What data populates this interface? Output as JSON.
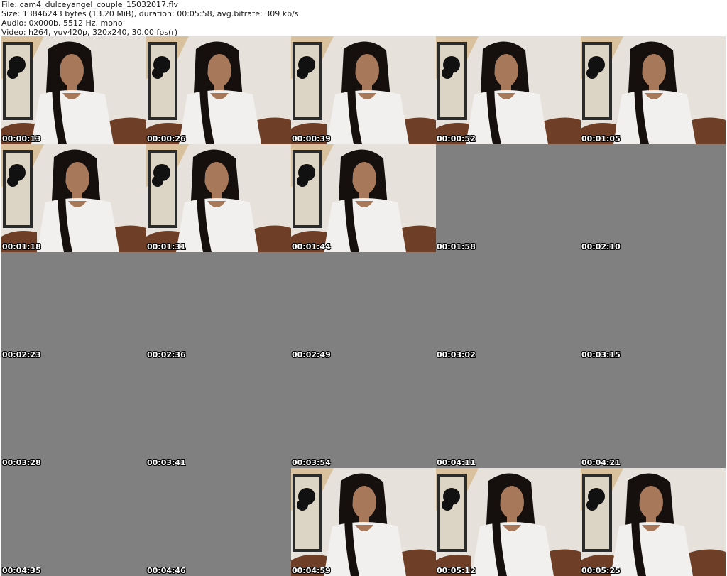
{
  "header": {
    "file": "File: cam4_dulceyangel_couple_15032017.flv",
    "size": "Size: 13846243 bytes (13.20 MiB), duration: 00:05:58, avg.bitrate: 309 kb/s",
    "audio": "Audio: 0x000b, 5512 Hz, mono",
    "video": "Video: h264, yuv420p, 320x240, 30.00 fps(r)"
  },
  "thumbnails": [
    {
      "time": "00:00:13",
      "has_frame": true
    },
    {
      "time": "00:00:26",
      "has_frame": true
    },
    {
      "time": "00:00:39",
      "has_frame": true
    },
    {
      "time": "00:00:52",
      "has_frame": true
    },
    {
      "time": "00:01:05",
      "has_frame": true
    },
    {
      "time": "00:01:18",
      "has_frame": true
    },
    {
      "time": "00:01:31",
      "has_frame": true
    },
    {
      "time": "00:01:44",
      "has_frame": true
    },
    {
      "time": "00:01:58",
      "has_frame": false
    },
    {
      "time": "00:02:10",
      "has_frame": false
    },
    {
      "time": "00:02:23",
      "has_frame": false
    },
    {
      "time": "00:02:36",
      "has_frame": false
    },
    {
      "time": "00:02:49",
      "has_frame": false
    },
    {
      "time": "00:03:02",
      "has_frame": false
    },
    {
      "time": "00:03:15",
      "has_frame": false
    },
    {
      "time": "00:03:28",
      "has_frame": false
    },
    {
      "time": "00:03:41",
      "has_frame": false
    },
    {
      "time": "00:03:54",
      "has_frame": false
    },
    {
      "time": "00:04:11",
      "has_frame": false
    },
    {
      "time": "00:04:21",
      "has_frame": false
    },
    {
      "time": "00:04:35",
      "has_frame": false
    },
    {
      "time": "00:04:46",
      "has_frame": false
    },
    {
      "time": "00:04:59",
      "has_frame": true
    },
    {
      "time": "00:05:12",
      "has_frame": true
    },
    {
      "time": "00:05:25",
      "has_frame": true
    }
  ],
  "colors": {
    "empty_frame": "#808080",
    "wall": "#e6e1da",
    "ceiling": "#d4b98c",
    "hair": "#15100e",
    "skin": "#a8785a",
    "shirt": "#f2f0ee",
    "couch": "#6e3f26"
  }
}
